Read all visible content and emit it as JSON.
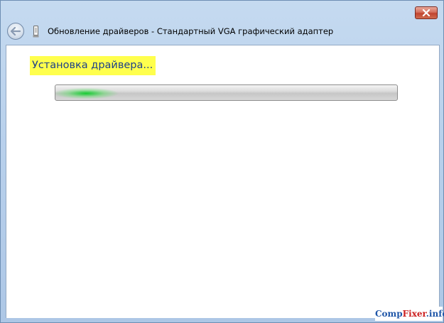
{
  "window": {
    "title": "Обновление драйверов - Стандартный VGA графический адаптер"
  },
  "titlebar": {
    "close_icon": "close-icon",
    "back_icon": "back-arrow-icon",
    "device_icon": "device-icon"
  },
  "content": {
    "heading": "Установка драйвера..."
  },
  "progress": {
    "state": "indeterminate",
    "fill_color": "#0ccb29"
  },
  "watermark": {
    "part1": "Comp",
    "part2": "Fixer",
    "part3": ".info"
  },
  "colors": {
    "frame": "#b9d1ec",
    "heading_highlight": "#ffff4d",
    "heading_text": "#1d3f8a",
    "close_button": "#c1442f"
  }
}
